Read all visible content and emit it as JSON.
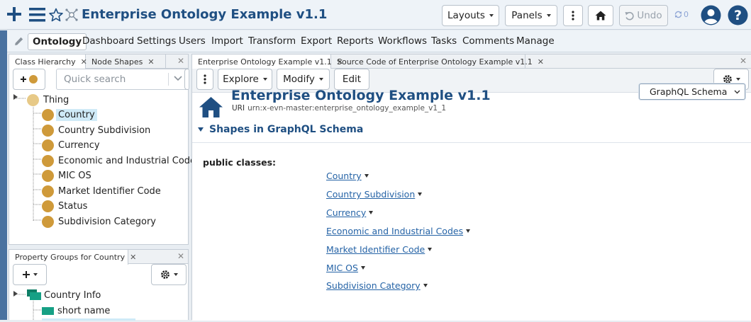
{
  "app": {
    "title": "Enterprise Ontology Example v1.1",
    "toolbar": {
      "layouts_label": "Layouts",
      "panels_label": "Panels",
      "undo_label": "Undo",
      "sync_count": "0"
    }
  },
  "menu": {
    "items": [
      "Ontology",
      "Dashboard",
      "Settings",
      "Users",
      "Import",
      "Transform",
      "Export",
      "Reports",
      "Workflows",
      "Tasks",
      "Comments",
      "Manage"
    ],
    "active": "Ontology"
  },
  "class_panel": {
    "tabs": [
      "Class Hierarchy",
      "Node Shapes"
    ],
    "search_placeholder": "Quick search",
    "root": "Thing",
    "items": [
      "Country",
      "Country Subdivision",
      "Currency",
      "Economic and Industrial Codes",
      "MIC OS",
      "Market Identifier Code",
      "Status",
      "Subdivision Category"
    ],
    "selected": "Country"
  },
  "property_panel": {
    "tab": "Property Groups for Country",
    "group": "Country Info",
    "items": [
      "short name"
    ]
  },
  "main": {
    "tabs": [
      "Enterprise Ontology Example v1.1",
      "Source Code of Enterprise Ontology Example v1.1"
    ],
    "toolbar": {
      "explore_label": "Explore",
      "modify_label": "Modify",
      "edit_label": "Edit"
    },
    "title": "Enterprise Ontology Example v1.1",
    "uri_label": "URI",
    "uri": "urn:x-evn-master:enterprise_ontology_example_v1_1",
    "view_select": "GraphQL Schema",
    "section_title": "Shapes in GraphQL Schema",
    "property_label": "public classes:",
    "classes": [
      "Country",
      "Country Subdivision",
      "Currency",
      "Economic and Industrial Codes",
      "Market Identifier Code",
      "MIC OS",
      "Subdivision Category"
    ]
  },
  "colors": {
    "brand_blue": "#1f4f82",
    "link_blue": "#2563a6",
    "class_dot": "#cf9a3a",
    "group_icon": "#16a085",
    "selection": "#cfeaf7"
  }
}
